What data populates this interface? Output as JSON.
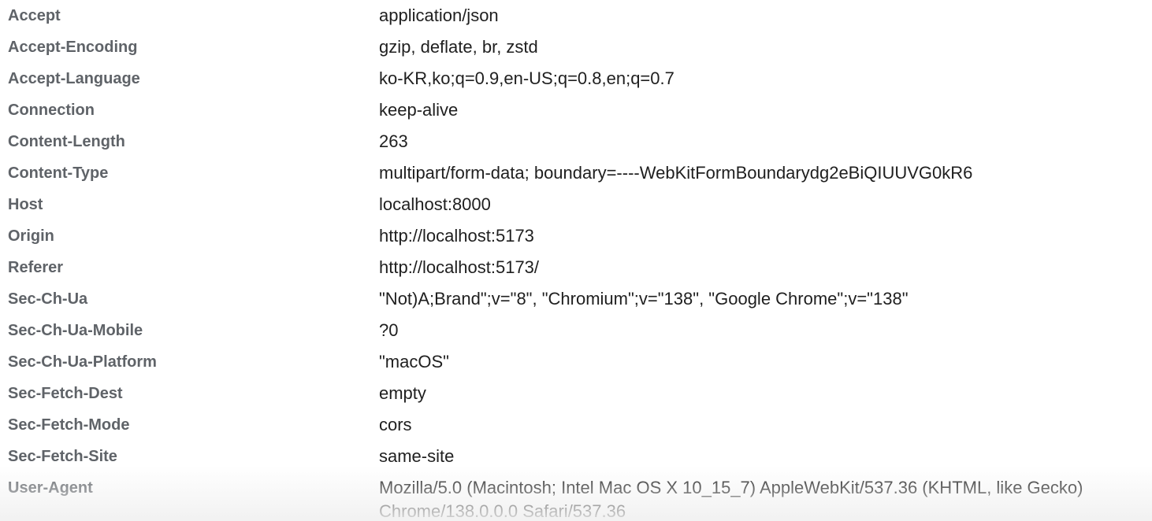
{
  "headers": [
    {
      "name": "Accept",
      "value": "application/json"
    },
    {
      "name": "Accept-Encoding",
      "value": "gzip, deflate, br, zstd"
    },
    {
      "name": "Accept-Language",
      "value": "ko-KR,ko;q=0.9,en-US;q=0.8,en;q=0.7"
    },
    {
      "name": "Connection",
      "value": "keep-alive"
    },
    {
      "name": "Content-Length",
      "value": "263"
    },
    {
      "name": "Content-Type",
      "value": "multipart/form-data; boundary=----WebKitFormBoundarydg2eBiQIUUVG0kR6"
    },
    {
      "name": "Host",
      "value": "localhost:8000"
    },
    {
      "name": "Origin",
      "value": "http://localhost:5173"
    },
    {
      "name": "Referer",
      "value": "http://localhost:5173/"
    },
    {
      "name": "Sec-Ch-Ua",
      "value": "\"Not)A;Brand\";v=\"8\", \"Chromium\";v=\"138\", \"Google Chrome\";v=\"138\""
    },
    {
      "name": "Sec-Ch-Ua-Mobile",
      "value": "?0"
    },
    {
      "name": "Sec-Ch-Ua-Platform",
      "value": "\"macOS\""
    },
    {
      "name": "Sec-Fetch-Dest",
      "value": "empty"
    },
    {
      "name": "Sec-Fetch-Mode",
      "value": "cors"
    },
    {
      "name": "Sec-Fetch-Site",
      "value": "same-site"
    },
    {
      "name": "User-Agent",
      "value": "Mozilla/5.0 (Macintosh; Intel Mac OS X 10_15_7) AppleWebKit/537.36 (KHTML, like Gecko) Chrome/138.0.0.0 Safari/537.36"
    }
  ]
}
